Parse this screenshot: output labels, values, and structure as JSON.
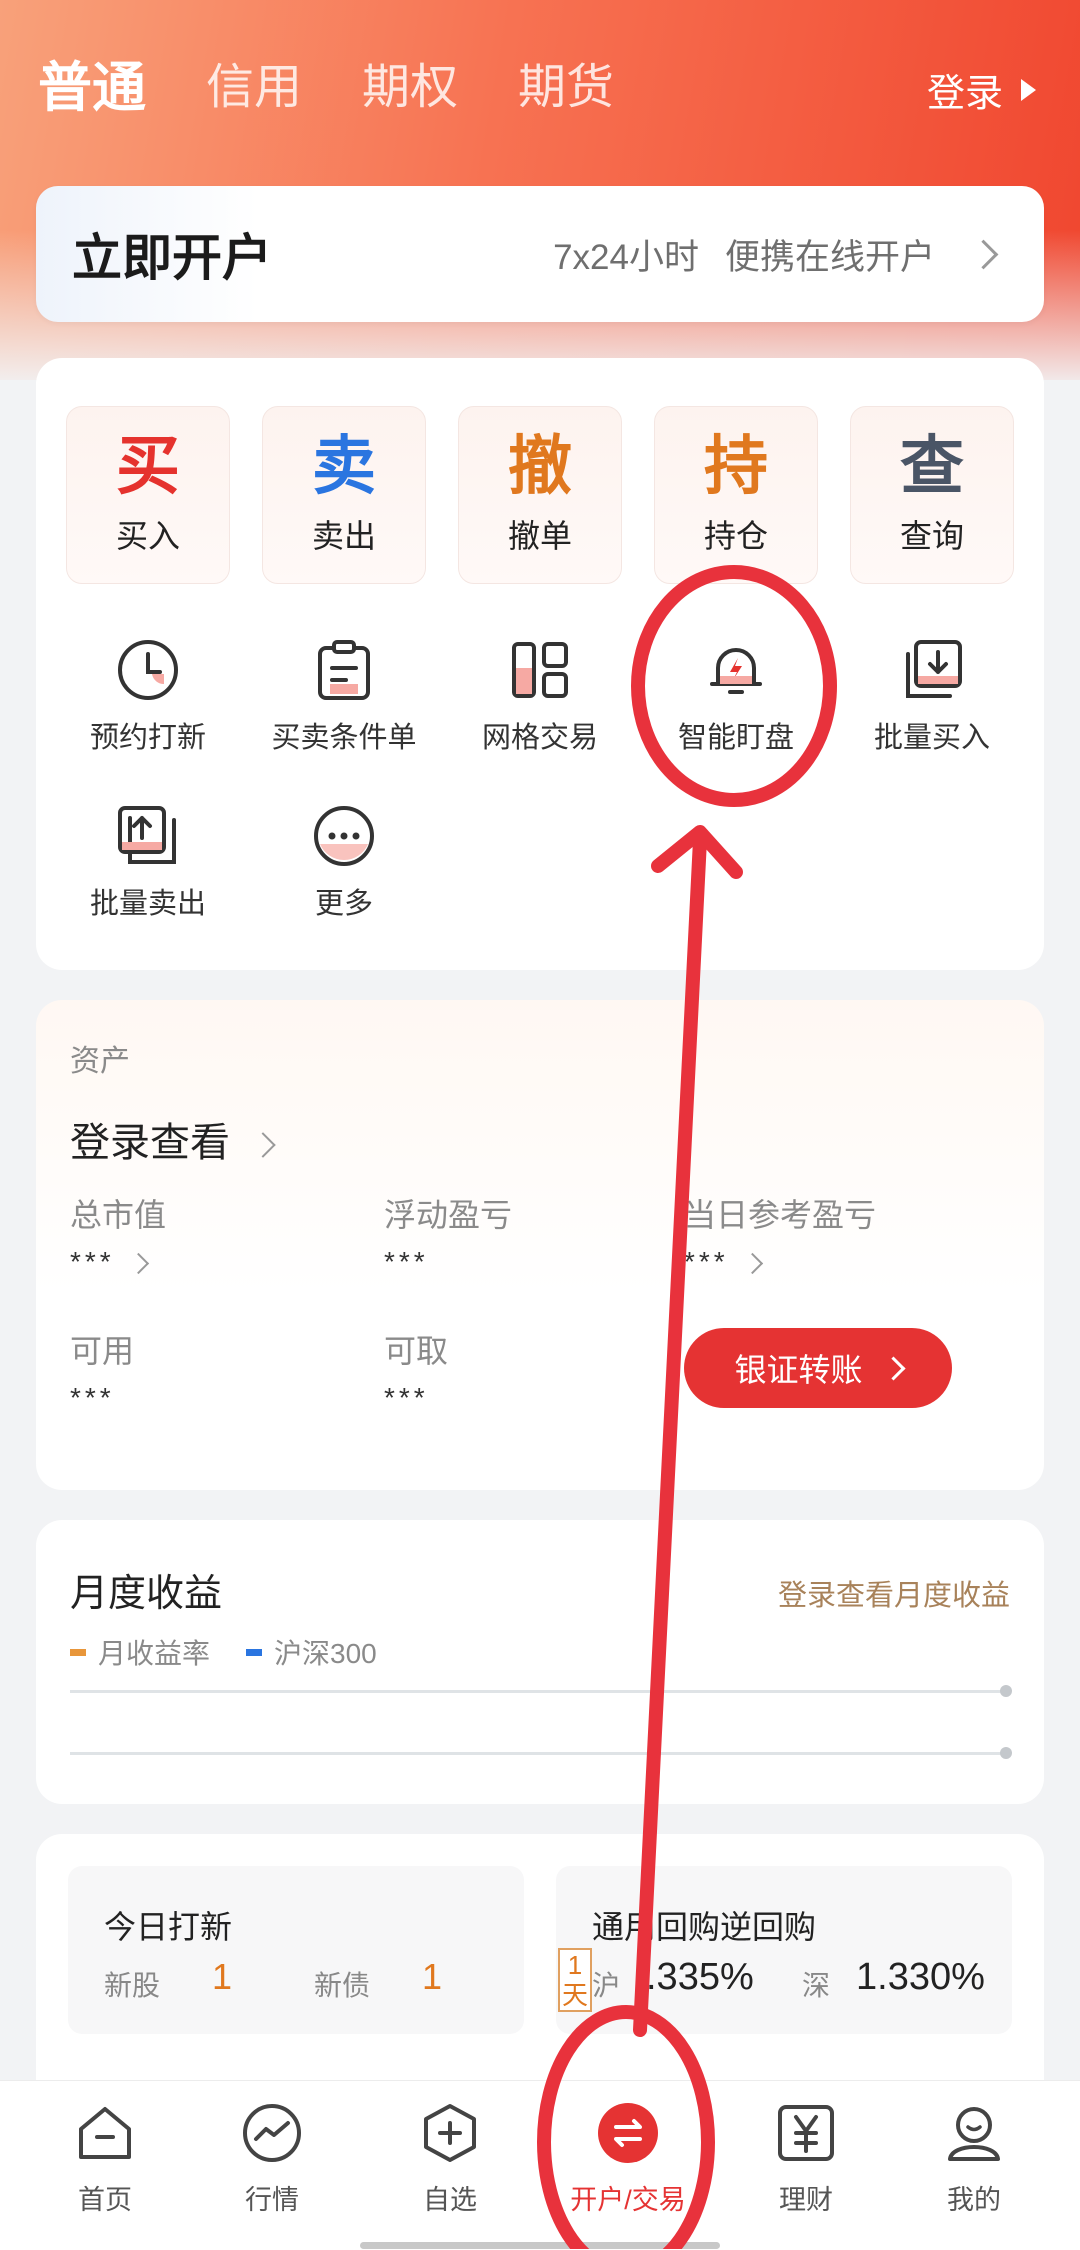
{
  "header": {
    "tabs": [
      "普通",
      "信用",
      "期权",
      "期货"
    ],
    "login_label": "登录"
  },
  "open_account": {
    "title": "立即开户",
    "sub1": "7x24小时",
    "sub2": "便携在线开户"
  },
  "trade_buttons": [
    {
      "glyph": "买",
      "label": "买入",
      "color": "#e5322d"
    },
    {
      "glyph": "卖",
      "label": "卖出",
      "color": "#2a75e0"
    },
    {
      "glyph": "撤",
      "label": "撤单",
      "color": "#e0781e"
    },
    {
      "glyph": "持",
      "label": "持仓",
      "color": "#e0781e"
    },
    {
      "glyph": "查",
      "label": "查询",
      "color": "#4a5566"
    }
  ],
  "tools": [
    {
      "label": "预约打新",
      "icon": "clock-icon"
    },
    {
      "label": "买卖条件单",
      "icon": "clipboard-icon"
    },
    {
      "label": "网格交易",
      "icon": "grid-icon"
    },
    {
      "label": "智能盯盘",
      "icon": "bell-icon"
    },
    {
      "label": "批量买入",
      "icon": "batch-buy-icon"
    },
    {
      "label": "批量卖出",
      "icon": "batch-sell-icon"
    },
    {
      "label": "更多",
      "icon": "more-icon"
    }
  ],
  "assets": {
    "section": "资产",
    "login_view": "登录查看",
    "total_market_value": {
      "label": "总市值",
      "value": "***"
    },
    "floating_pl": {
      "label": "浮动盈亏",
      "value": "***"
    },
    "daily_pl": {
      "label": "当日参考盈亏",
      "value": "***"
    },
    "available": {
      "label": "可用",
      "value": "***"
    },
    "withdrawable": {
      "label": "可取",
      "value": "***"
    },
    "transfer_label": "银证转账"
  },
  "monthly": {
    "title": "月度收益",
    "login_link": "登录查看月度收益",
    "legend": [
      {
        "name": "月收益率",
        "color": "#e8963a"
      },
      {
        "name": "沪深300",
        "color": "#2a75e0"
      }
    ]
  },
  "ipo": {
    "title": "今日打新",
    "stock_label": "新股",
    "stock_count": "1",
    "bond_label": "新债",
    "bond_count": "1"
  },
  "repo": {
    "title": "通用回购逆回购",
    "tag": "1天",
    "sh_label": "沪",
    "sh_rate": ".335%",
    "sz_label": "深",
    "sz_rate": "1.330%"
  },
  "nav": [
    {
      "label": "首页"
    },
    {
      "label": "行情"
    },
    {
      "label": "自选"
    },
    {
      "label": "开户/交易"
    },
    {
      "label": "理财"
    },
    {
      "label": "我的"
    }
  ],
  "colors": {
    "accent": "#e53333",
    "annotation": "#e8323c"
  }
}
